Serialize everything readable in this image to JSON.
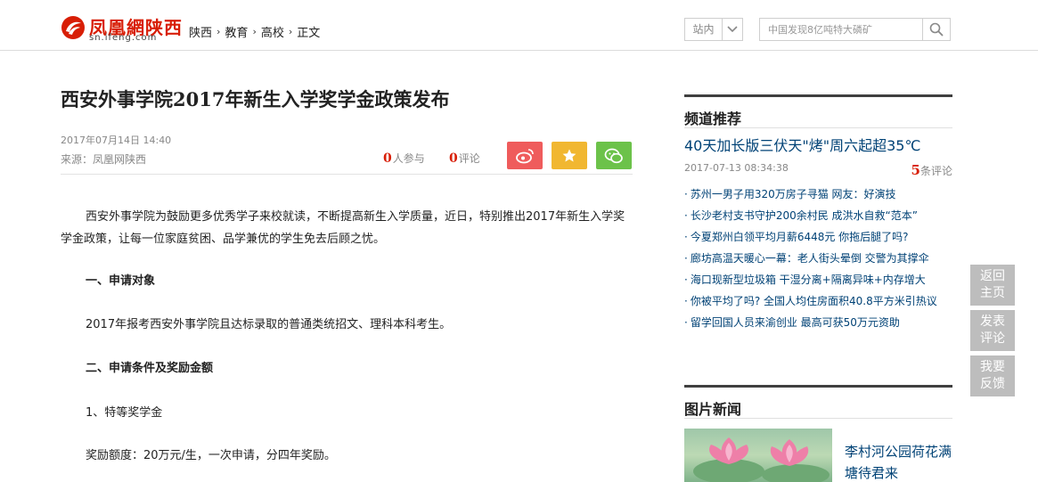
{
  "header": {
    "logo_text": "凤凰網陕西",
    "logo_sub": "sn.ifeng.com",
    "breadcrumb": [
      "陕西",
      "教育",
      "高校",
      "正文"
    ],
    "site_select": "站内",
    "search_placeholder": "中国发现8亿吨特大磷矿"
  },
  "article": {
    "title": "西安外事学院2017年新生入学奖学金政策发布",
    "date": "2017年07月14日 14:40",
    "source": "来源：凤凰网陕西",
    "participants_count": "0",
    "participants_label": "人参与",
    "comments_count": "0",
    "comments_label": "评论",
    "paragraphs": [
      "西安外事学院为鼓励更多优秀学子来校就读，不断提高新生入学质量，近日，特别推出2017年新生入学奖学金政策，让每一位家庭贫困、品学兼优的学生免去后顾之忧。",
      "一、申请对象",
      "2017年报考西安外事学院且达标录取的普通类统招文、理科本科考生。",
      "二、申请条件及奖励金额",
      "1、特等奖学金",
      "奖励额度：20万元/生，一次申请，分四年奖励。"
    ]
  },
  "share": {
    "colors": {
      "weibo": "#ef5c5c",
      "favorite": "#f1b731",
      "wechat": "#6cc24a"
    }
  },
  "sidebar": {
    "channel_title": "频道推荐",
    "feature_title": "40天加长版三伏天\"烤\"周六起超35℃",
    "feature_time": "2017-07-13 08:34:38",
    "feature_comments_count": "5",
    "feature_comments_label": "条评论",
    "news": [
      "苏州一男子用320万房子寻猫 网友：好演技",
      "长沙老村支书守护200余村民 成洪水自救“范本”",
      "今夏郑州白领平均月薪6448元 你拖后腿了吗?",
      "廊坊高温天暖心一幕：老人街头晕倒 交警为其撑伞",
      "海口现新型垃圾箱 干湿分离+隔离异味+内存增大",
      "你被平均了吗? 全国人均住房面积40.8平方米引热议",
      "留学回国人员来渝创业 最高可获50万元资助"
    ],
    "photo_title": "图片新闻",
    "photo_caption": "李村河公园荷花满塘待君来"
  },
  "float_tools": [
    "返回主页",
    "发表评论",
    "我要反馈"
  ],
  "colors": {
    "accent_red": "#d81e06",
    "link_blue": "#004276",
    "float_gray": "#bdbdbd"
  }
}
